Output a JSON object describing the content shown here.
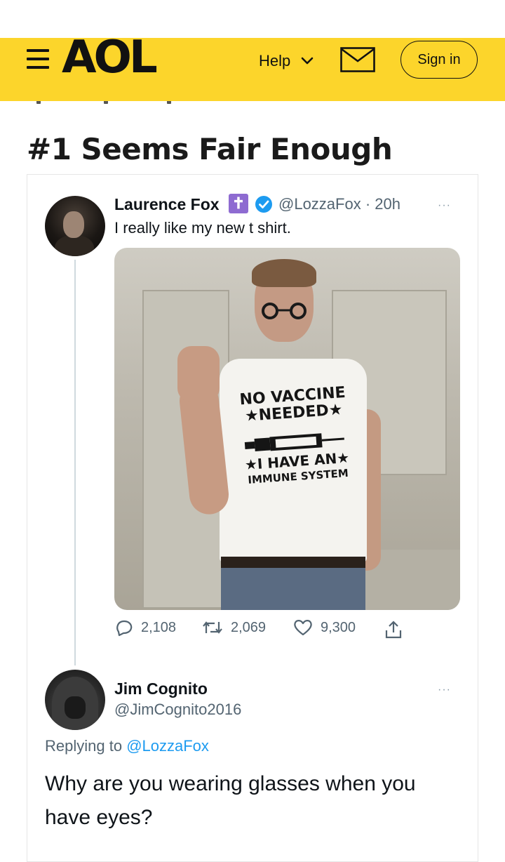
{
  "header": {
    "brand": "AOL",
    "help_label": "Help",
    "signin_label": "Sign in",
    "background_color": "#fcd52b"
  },
  "article": {
    "title": "#1 Seems Fair Enough"
  },
  "tweet1": {
    "name": "Laurence Fox",
    "badge_symbol": "✝",
    "handle_time": "@LozzaFox · 20h",
    "text": "I really like my new t shirt.",
    "shirt_line1": "NO VACCINE",
    "shirt_line2": "★NEEDED★",
    "shirt_line3": "★I HAVE AN★",
    "shirt_line4": "IMMUNE SYSTEM",
    "replies": "2,108",
    "retweets": "2,069",
    "likes": "9,300",
    "more": "···"
  },
  "tweet2": {
    "name": "Jim Cognito",
    "handle": "@JimCognito2016",
    "replying_prefix": "Replying to",
    "replying_handle": "@LozzaFox",
    "text": "Why are you wearing glasses when you have eyes?",
    "more": "···"
  },
  "colors": {
    "link": "#1d9bf0",
    "muted": "#536471",
    "badge": "#8e6bd1"
  },
  "icons": [
    "menu-icon",
    "chevron-down-icon",
    "mail-icon",
    "verified-icon",
    "reply-icon",
    "retweet-icon",
    "like-icon",
    "share-icon"
  ]
}
